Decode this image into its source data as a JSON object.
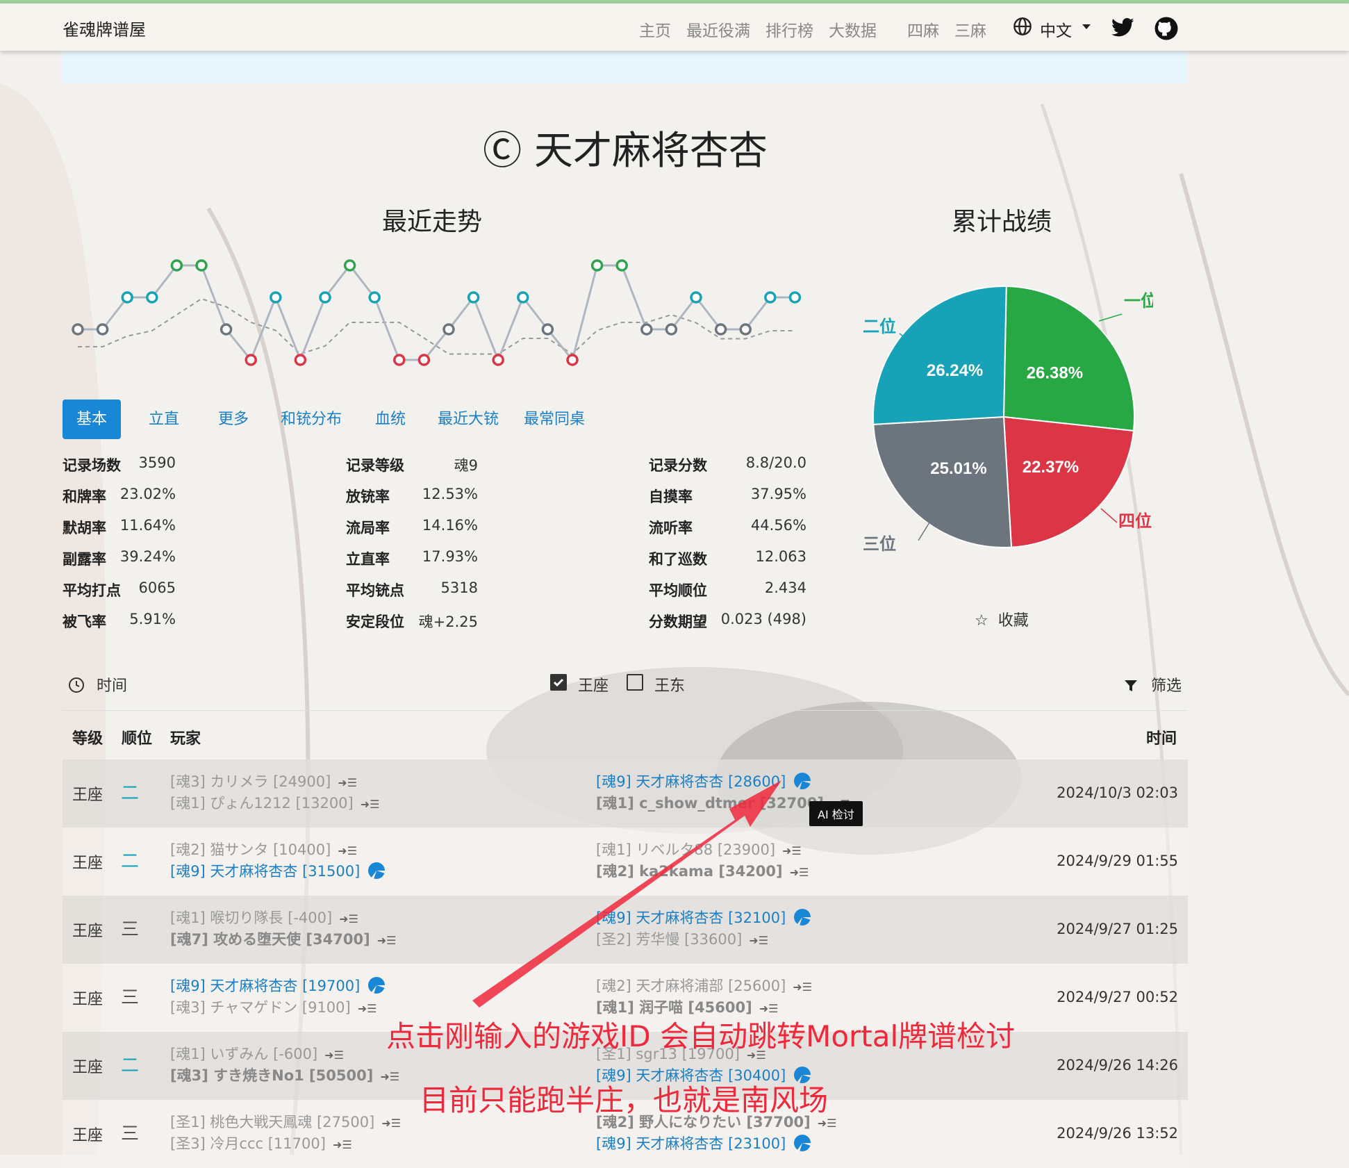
{
  "navbar": {
    "brand": "雀魂牌谱屋",
    "items": [
      {
        "label": "主页",
        "active": true
      },
      {
        "label": "最近役满",
        "active": false
      },
      {
        "label": "排行榜",
        "active": false
      },
      {
        "label": "大数据",
        "active": false
      },
      {
        "label": "四麻",
        "active": true
      },
      {
        "label": "三麻",
        "active": false
      }
    ],
    "language": "中文",
    "icons": [
      "globe-icon",
      "twitter-icon",
      "github-icon"
    ]
  },
  "player": {
    "title": "Ⓒ 天才麻将杏杏"
  },
  "trend": {
    "title": "最近走势",
    "ranks": [
      4,
      4,
      3,
      3,
      1,
      1,
      4,
      5,
      3,
      5,
      3,
      1,
      3,
      5,
      5,
      4,
      3,
      5,
      3,
      4,
      5,
      1,
      1,
      4,
      4,
      3,
      4,
      4,
      3,
      3
    ],
    "colors": {
      "1": "#2ea44f",
      "3": "#17a2b8",
      "4": "#6c757d",
      "5": "#dc3545"
    }
  },
  "cumulative": {
    "title": "累计战绩",
    "slices": [
      {
        "label": "一位",
        "value": 26.38,
        "text": "26.38%",
        "color": "#28a745"
      },
      {
        "label": "四位",
        "value": 22.37,
        "text": "22.37%",
        "color": "#dc3545"
      },
      {
        "label": "三位",
        "value": 25.01,
        "text": "25.01%",
        "color": "#6c757d"
      },
      {
        "label": "二位",
        "value": 26.24,
        "text": "26.24%",
        "color": "#17a2b8"
      }
    ],
    "favorite": "收藏"
  },
  "tabs": [
    "基本",
    "立直",
    "更多",
    "和铳分布",
    "血统",
    "最近大铳",
    "最常同桌"
  ],
  "stats": [
    [
      {
        "label": "记录场数",
        "value": "3590"
      },
      {
        "label": "和牌率",
        "value": "23.02%"
      },
      {
        "label": "默胡率",
        "value": "11.64%"
      },
      {
        "label": "副露率",
        "value": "39.24%"
      },
      {
        "label": "平均打点",
        "value": "6065"
      },
      {
        "label": "被飞率",
        "value": "5.91%"
      }
    ],
    [
      {
        "label": "记录等级",
        "value": "魂9"
      },
      {
        "label": "放铳率",
        "value": "12.53%"
      },
      {
        "label": "流局率",
        "value": "14.16%"
      },
      {
        "label": "立直率",
        "value": "17.93%"
      },
      {
        "label": "平均铳点",
        "value": "5318"
      },
      {
        "label": "安定段位",
        "value": "魂+2.25"
      }
    ],
    [
      {
        "label": "记录分数",
        "value": "8.8/20.0"
      },
      {
        "label": "自摸率",
        "value": "37.95%"
      },
      {
        "label": "流听率",
        "value": "44.56%"
      },
      {
        "label": "和了巡数",
        "value": "12.063"
      },
      {
        "label": "平均顺位",
        "value": "2.434"
      },
      {
        "label": "分数期望",
        "value": "0.023 (498)"
      }
    ]
  ],
  "toolbar": {
    "time": "时间",
    "filter1": "王座",
    "filter2": "王东",
    "filter_btn": "筛选"
  },
  "table": {
    "headers": {
      "level": "等级",
      "rank": "顺位",
      "player": "玩家",
      "time": "时间"
    },
    "rows": [
      {
        "level": "王座",
        "pos": "二",
        "posColor": "#17a2b8",
        "time": "2024/10/3 02:03",
        "p": [
          "[魂3] カリメラ [24900]",
          "[魂1] ぴょん1212 [13200]",
          "[魂9] 天才麻将杏杏 [28600]",
          "[魂1] c_show_dtmer [32700]"
        ],
        "me": 2,
        "bold": 3
      },
      {
        "level": "王座",
        "pos": "二",
        "posColor": "#17a2b8",
        "time": "2024/9/29 01:55",
        "p": [
          "[魂2] 猫サンタ [10400]",
          "[魂9] 天才麻将杏杏 [31500]",
          "[魂1] リベルタ88 [23900]",
          "[魂2] ka2kama [34200]"
        ],
        "me": 1,
        "bold": 3
      },
      {
        "level": "王座",
        "pos": "三",
        "posColor": "#555",
        "time": "2024/9/27 01:25",
        "p": [
          "[魂1] 喉切り隊長 [-400]",
          "[魂7] 攻める堕天使 [34700]",
          "[魂9] 天才麻将杏杏 [32100]",
          "[圣2] 芳华慢 [33600]"
        ],
        "me": 2,
        "bold": 1
      },
      {
        "level": "王座",
        "pos": "三",
        "posColor": "#555",
        "time": "2024/9/27 00:52",
        "p": [
          "[魂9] 天才麻将杏杏 [19700]",
          "[魂3] チャマゲドン [9100]",
          "[魂2] 天才麻将浦部 [25600]",
          "[魂1] 润子喵 [45600]"
        ],
        "me": 0,
        "bold": 3
      },
      {
        "level": "王座",
        "pos": "二",
        "posColor": "#17a2b8",
        "time": "2024/9/26 14:26",
        "p": [
          "[魂1] いずみん [-600]",
          "[魂3] すき焼きNo1 [50500]",
          "[圣1] sgr13 [19700]",
          "[魂9] 天才麻将杏杏 [30400]"
        ],
        "me": 3,
        "bold": 1
      },
      {
        "level": "王座",
        "pos": "三",
        "posColor": "#555",
        "time": "2024/9/26 13:52",
        "p": [
          "[圣1] 桃色大戦天鳳魂 [27500]",
          "[圣3] 冷月ccc [11700]",
          "[魂2] 野人になりたい [37700]",
          "[魂9] 天才麻将杏杏 [23100]"
        ],
        "me": 3,
        "bold": 2
      }
    ]
  },
  "tooltip": "AI 检讨",
  "annotation": {
    "line1": "点击刚输入的游戏ID 会自动跳转Mortal牌谱检讨",
    "line2": "目前只能跑半庄，也就是南风场"
  }
}
